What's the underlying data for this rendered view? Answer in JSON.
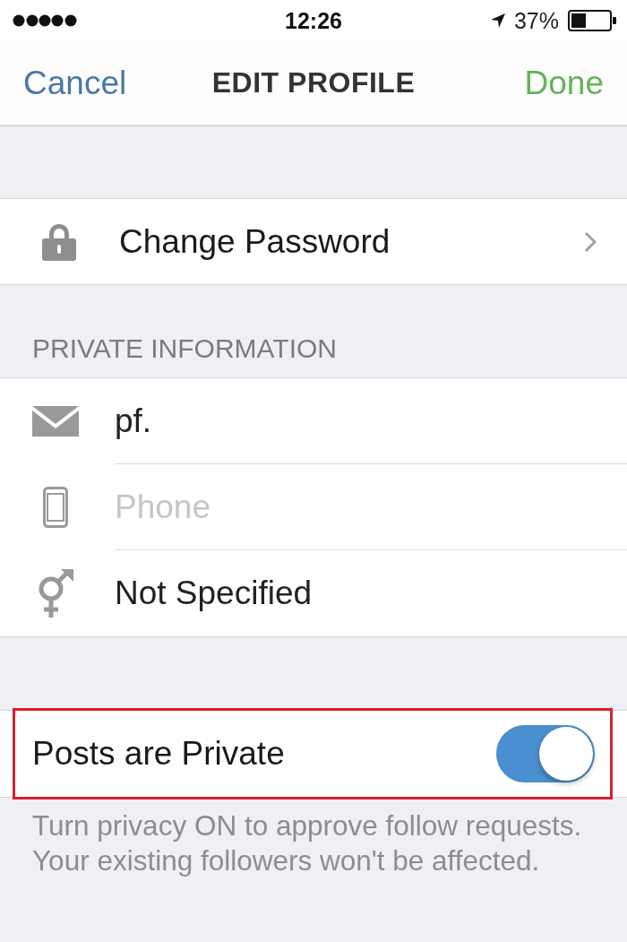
{
  "status_bar": {
    "time": "12:26",
    "battery": "37%"
  },
  "nav_bar": {
    "cancel": "Cancel",
    "title": "EDIT PROFILE",
    "done": "Done"
  },
  "change_password": {
    "label": "Change Password"
  },
  "private_information": {
    "header": "PRIVATE INFORMATION",
    "email": {
      "value": "pf."
    },
    "phone": {
      "placeholder": "Phone"
    },
    "gender": {
      "value": "Not Specified"
    }
  },
  "privacy": {
    "label": "Posts are Private",
    "on": true,
    "highlighted": true,
    "note": "Turn privacy ON to approve follow requests. Your existing followers won't be affected."
  }
}
